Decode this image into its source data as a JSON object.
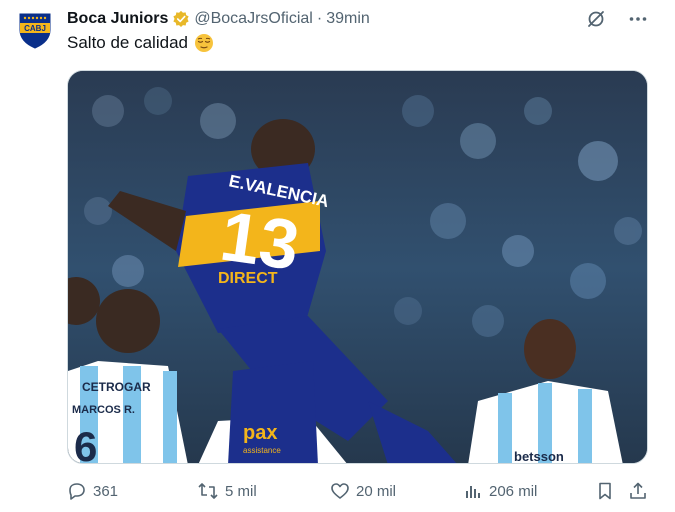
{
  "tweet": {
    "author_name": "Boca Juniors",
    "handle": "@BocaJrsOficial",
    "separator": "·",
    "time": "39min",
    "text": "Salto de calidad",
    "avatar_text": "CABJ",
    "image_texts": {
      "jersey_name": "E.VALENCIA",
      "jersey_number": "13",
      "sponsor": "DIRECT",
      "shorts_sponsor": "pax",
      "shorts_sponsor_sub": "assistance",
      "opponent_sponsor": "CETROGAR",
      "opponent_name": "MARCOS R.",
      "opponent_number": "6",
      "opponent_sponsor_right": "betsson"
    }
  },
  "actions": {
    "reply_count": "361",
    "retweet_count": "5 mil",
    "like_count": "20 mil",
    "views_count": "206 mil"
  },
  "icons": {
    "verified": "verified-badge-icon",
    "grok": "grok-icon",
    "more": "more-icon",
    "emoji": "relieved-face-emoji",
    "reply": "reply-icon",
    "retweet": "retweet-icon",
    "like": "heart-icon",
    "views": "views-icon",
    "bookmark": "bookmark-icon",
    "share": "share-icon"
  },
  "colors": {
    "text_primary": "#0f1419",
    "text_secondary": "#536471",
    "verified_gold": "#e8b829",
    "boca_blue": "#0a2f8a",
    "boca_gold": "#f3b51b",
    "racing_sky": "#7fc4ea"
  }
}
